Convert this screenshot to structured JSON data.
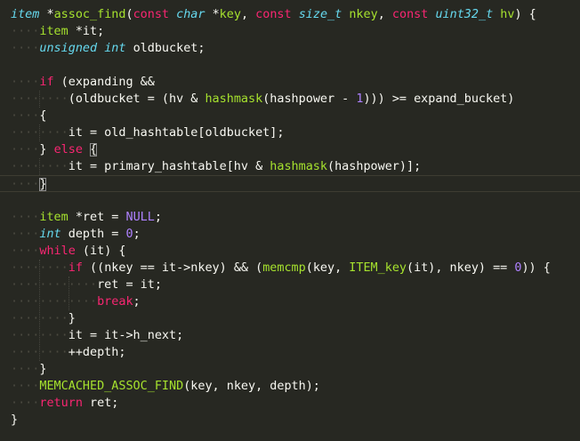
{
  "colors": {
    "background": "#272822",
    "text": "#f8f8f2",
    "keyword": "#f92672",
    "type": "#66d9ef",
    "function": "#a6e22e",
    "number": "#ae81ff",
    "whitespace": "#4b4a40",
    "current_line": "#3e3d32"
  },
  "code": {
    "current_line": 10,
    "lines": [
      [
        [
          "t",
          "item"
        ],
        [
          "p",
          " *"
        ],
        [
          "f",
          "assoc_find"
        ],
        [
          "p",
          "("
        ],
        [
          "k",
          "const"
        ],
        [
          "p",
          " "
        ],
        [
          "t",
          "char"
        ],
        [
          "p",
          " *"
        ],
        [
          "f",
          "key"
        ],
        [
          "p",
          ", "
        ],
        [
          "k",
          "const"
        ],
        [
          "p",
          " "
        ],
        [
          "t",
          "size_t"
        ],
        [
          "p",
          " "
        ],
        [
          "f",
          "nkey"
        ],
        [
          "p",
          ", "
        ],
        [
          "k",
          "const"
        ],
        [
          "p",
          " "
        ],
        [
          "t",
          "uint32_t"
        ],
        [
          "p",
          " "
        ],
        [
          "f",
          "hv"
        ],
        [
          "p",
          ") {"
        ]
      ],
      [
        [
          "ws",
          "····"
        ],
        [
          "f",
          "item"
        ],
        [
          "p",
          " *it;"
        ]
      ],
      [
        [
          "ws",
          "····"
        ],
        [
          "t",
          "unsigned"
        ],
        [
          "p",
          " "
        ],
        [
          "t",
          "int"
        ],
        [
          "p",
          " oldbucket;"
        ]
      ],
      [],
      [
        [
          "ws",
          "····"
        ],
        [
          "k",
          "if"
        ],
        [
          "p",
          " (expanding &&"
        ]
      ],
      [
        [
          "ws",
          "········"
        ],
        [
          "p",
          "(oldbucket = (hv & "
        ],
        [
          "f",
          "hashmask"
        ],
        [
          "p",
          "(hashpower - "
        ],
        [
          "n",
          "1"
        ],
        [
          "p",
          ")))"
        ],
        [
          "p",
          " >= expand_bucket)"
        ]
      ],
      [
        [
          "ws",
          "····"
        ],
        [
          "p",
          "{"
        ]
      ],
      [
        [
          "ws",
          "········"
        ],
        [
          "p",
          "it = old_hashtable[oldbucket];"
        ]
      ],
      [
        [
          "ws",
          "····"
        ],
        [
          "p",
          "} "
        ],
        [
          "k",
          "else"
        ],
        [
          "p",
          " "
        ],
        [
          "bm",
          "{"
        ]
      ],
      [
        [
          "ws",
          "········"
        ],
        [
          "p",
          "it = primary_hashtable[hv & "
        ],
        [
          "f",
          "hashmask"
        ],
        [
          "p",
          "(hashpower)];"
        ]
      ],
      [
        [
          "ws",
          "····"
        ],
        [
          "bm",
          "}"
        ]
      ],
      [],
      [
        [
          "ws",
          "····"
        ],
        [
          "f",
          "item"
        ],
        [
          "p",
          " *ret = "
        ],
        [
          "n",
          "NULL"
        ],
        [
          "p",
          ";"
        ]
      ],
      [
        [
          "ws",
          "····"
        ],
        [
          "t",
          "int"
        ],
        [
          "p",
          " depth = "
        ],
        [
          "n",
          "0"
        ],
        [
          "p",
          ";"
        ]
      ],
      [
        [
          "ws",
          "····"
        ],
        [
          "k",
          "while"
        ],
        [
          "p",
          " (it) {"
        ]
      ],
      [
        [
          "ws",
          "········"
        ],
        [
          "k",
          "if"
        ],
        [
          "p",
          " ((nkey == it->nkey) && ("
        ],
        [
          "f",
          "memcmp"
        ],
        [
          "p",
          "(key, "
        ],
        [
          "f",
          "ITEM_key"
        ],
        [
          "p",
          "(it), nkey) == "
        ],
        [
          "n",
          "0"
        ],
        [
          "p",
          ")) {"
        ]
      ],
      [
        [
          "ws",
          "············"
        ],
        [
          "p",
          "ret = it;"
        ]
      ],
      [
        [
          "ws",
          "············"
        ],
        [
          "k",
          "break"
        ],
        [
          "p",
          ";"
        ]
      ],
      [
        [
          "ws",
          "········"
        ],
        [
          "p",
          "}"
        ]
      ],
      [
        [
          "ws",
          "········"
        ],
        [
          "p",
          "it = it->h_next;"
        ]
      ],
      [
        [
          "ws",
          "········"
        ],
        [
          "p",
          "++depth;"
        ]
      ],
      [
        [
          "ws",
          "····"
        ],
        [
          "p",
          "}"
        ]
      ],
      [
        [
          "ws",
          "····"
        ],
        [
          "f",
          "MEMCACHED_ASSOC_FIND"
        ],
        [
          "p",
          "(key, nkey, depth);"
        ]
      ],
      [
        [
          "ws",
          "····"
        ],
        [
          "k",
          "return"
        ],
        [
          "p",
          " ret;"
        ]
      ],
      [
        [
          "p",
          "}"
        ]
      ]
    ]
  }
}
